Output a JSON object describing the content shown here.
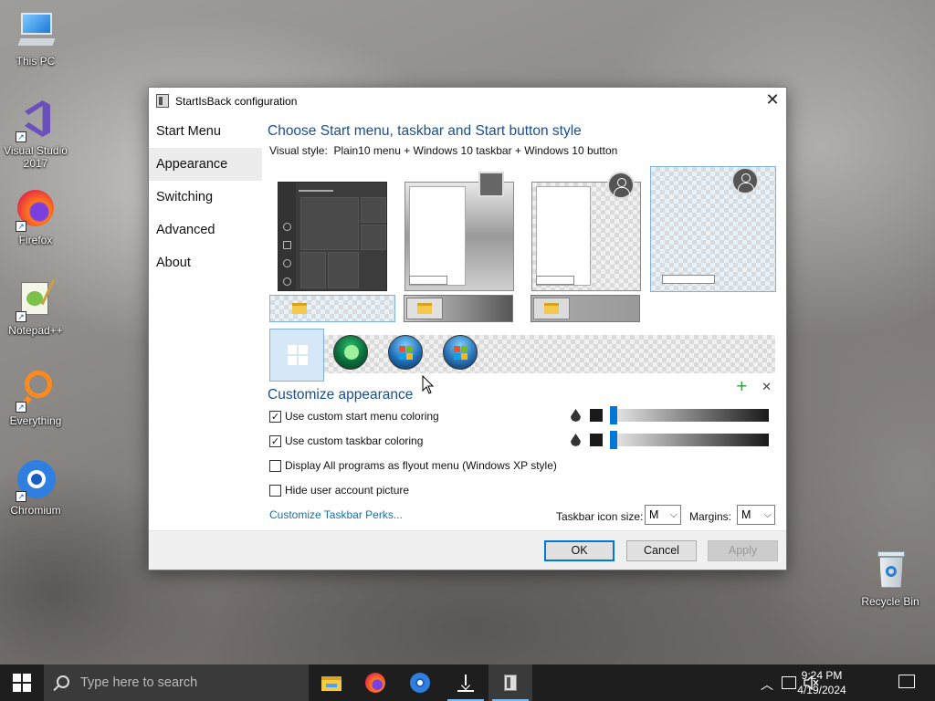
{
  "desktop": {
    "icons": [
      {
        "label": "This PC",
        "icon": "computer-icon"
      },
      {
        "label": "Visual Studio 2017",
        "icon": "visual-studio-icon"
      },
      {
        "label": "Firefox",
        "icon": "firefox-icon"
      },
      {
        "label": "Notepad++",
        "icon": "notepad-plus-plus-icon"
      },
      {
        "label": "Everything",
        "icon": "everything-search-icon"
      },
      {
        "label": "Chromium",
        "icon": "chromium-icon"
      },
      {
        "label": "Recycle Bin",
        "icon": "recycle-bin-icon"
      }
    ]
  },
  "dialog": {
    "title": "StartIsBack configuration",
    "close_glyph": "✕",
    "nav": [
      {
        "label": "Start Menu",
        "active": false
      },
      {
        "label": "Appearance",
        "active": true
      },
      {
        "label": "Switching",
        "active": false
      },
      {
        "label": "Advanced",
        "active": false
      },
      {
        "label": "About",
        "active": false
      }
    ],
    "style_heading": "Choose Start menu, taskbar and Start button style",
    "visual_style_label": "Visual style:",
    "visual_style_value": "Plain10 menu + Windows 10 taskbar + Windows 10 button",
    "strip_add_glyph": "+",
    "strip_remove_glyph": "✕",
    "customize_heading": "Customize appearance",
    "checkboxes": [
      {
        "label": "Use custom start menu coloring",
        "checked": true
      },
      {
        "label": "Use custom taskbar coloring",
        "checked": true
      },
      {
        "label": "Display All programs as flyout menu (Windows XP style)",
        "checked": false
      },
      {
        "label": "Hide user account picture",
        "checked": false
      }
    ],
    "check_glyph": "✓",
    "perks_link": "Customize Taskbar Perks...",
    "taskbar_icon_size_label": "Taskbar icon size:",
    "taskbar_icon_size_value": "M",
    "margins_label": "Margins:",
    "margins_value": "M",
    "dropdown_glyph": "⌵",
    "buttons": {
      "ok": "OK",
      "cancel": "Cancel",
      "apply": "Apply"
    },
    "colors": {
      "heading": "#1a4f8c",
      "link": "#1a6fa8",
      "accent": "#0078d7",
      "selection": "#e5f1fb"
    }
  },
  "taskbar": {
    "search_placeholder": "Type here to search",
    "apps": [
      "file-explorer-icon",
      "firefox-icon",
      "chromium-icon",
      "download-icon",
      "startisback-config-icon"
    ],
    "time": "9:24 PM",
    "date": "4/19/2024",
    "tray_chevron": "︿"
  }
}
